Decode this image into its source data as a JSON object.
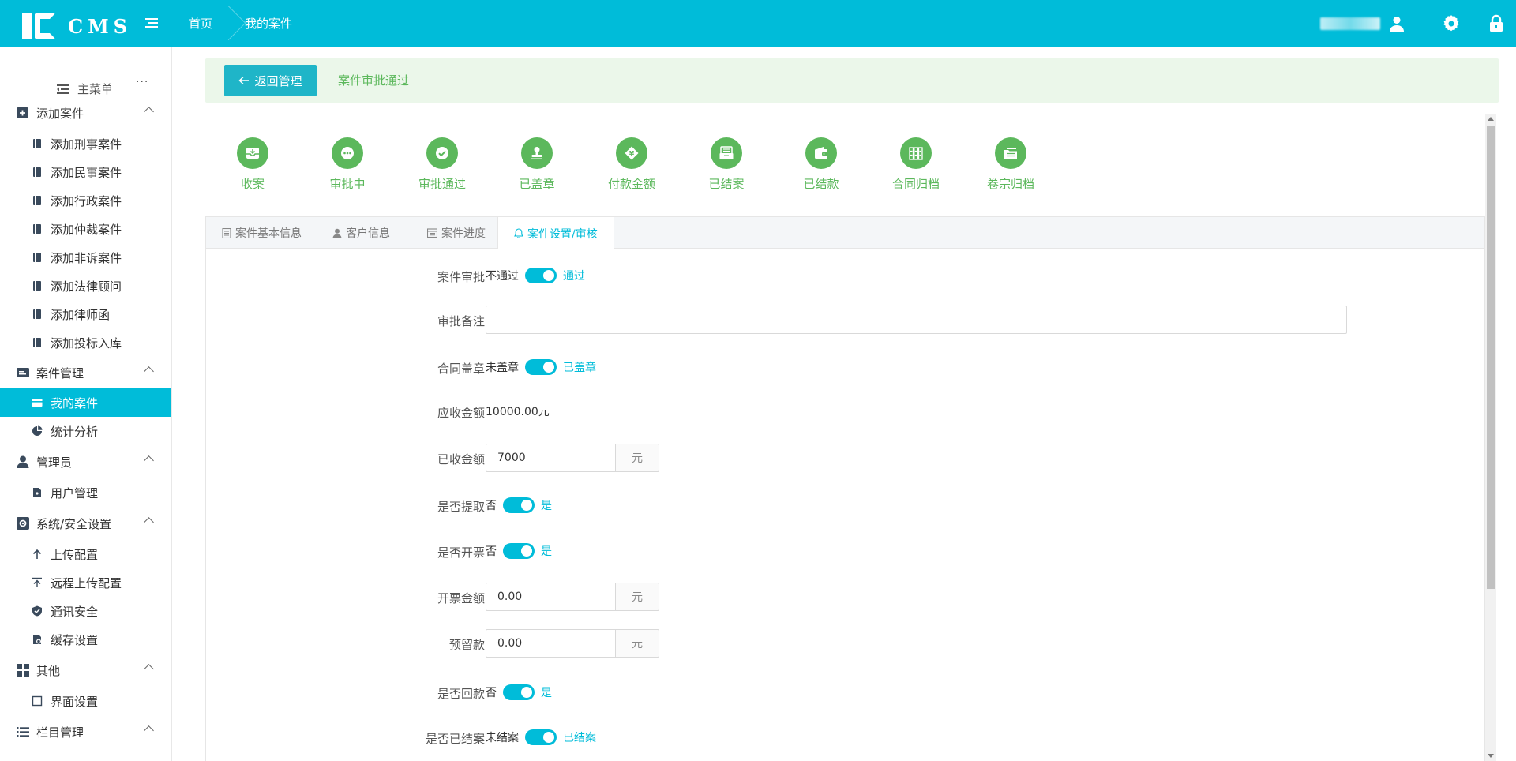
{
  "header": {
    "logo_text": "CMS",
    "breadcrumb": [
      "首页",
      "我的案件"
    ]
  },
  "sidebar": {
    "main_menu_label": "主菜单",
    "groups": [
      {
        "label": "添加案件",
        "icon": "plus-square-icon",
        "items": [
          "添加刑事案件",
          "添加民事案件",
          "添加行政案件",
          "添加仲裁案件",
          "添加非诉案件",
          "添加法律顾问",
          "添加律师函",
          "添加投标入库"
        ]
      },
      {
        "label": "案件管理",
        "icon": "id-card-icon",
        "items": [
          "我的案件",
          "统计分析"
        ]
      },
      {
        "label": "管理员",
        "icon": "user-icon",
        "items": [
          "用户管理"
        ]
      },
      {
        "label": "系统/安全设置",
        "icon": "settings-box-icon",
        "items": [
          "上传配置",
          "远程上传配置",
          "通讯安全",
          "缓存设置"
        ]
      },
      {
        "label": "其他",
        "icon": "grid-icon",
        "items": [
          "界面设置"
        ]
      },
      {
        "label": "栏目管理",
        "icon": "list-icon",
        "items": []
      }
    ]
  },
  "back_bar": {
    "button_label": "返回管理",
    "status": "案件审批通过"
  },
  "steps": [
    "收案",
    "审批中",
    "审批通过",
    "已盖章",
    "付款金额",
    "已结案",
    "已结款",
    "合同归档",
    "卷宗归档"
  ],
  "tabs": [
    "案件基本信息",
    "客户信息",
    "案件进度",
    "案件设置/审核"
  ],
  "form": {
    "approval": {
      "label": "案件审批",
      "off": "不通过",
      "on": "通过"
    },
    "remark": {
      "label": "审批备注",
      "value": ""
    },
    "stamp": {
      "label": "合同盖章",
      "off": "未盖章",
      "on": "已盖章"
    },
    "receivable": {
      "label": "应收金额",
      "value": "10000.00元"
    },
    "received": {
      "label": "已收金额",
      "value": "7000",
      "unit": "元"
    },
    "extract": {
      "label": "是否提取",
      "off": "否",
      "on": "是"
    },
    "invoice": {
      "label": "是否开票",
      "off": "否",
      "on": "是"
    },
    "invoice_amount": {
      "label": "开票金额",
      "value": "0.00",
      "unit": "元"
    },
    "reserve": {
      "label": "预留款",
      "value": "0.00",
      "unit": "元"
    },
    "payback": {
      "label": "是否回款",
      "off": "否",
      "on": "是"
    },
    "closed": {
      "label": "是否已结案",
      "off": "未结案",
      "on": "已结案"
    }
  },
  "colors": {
    "primary": "#00bcd9",
    "success": "#5cb85c",
    "success_bg": "#ebf7ea"
  }
}
